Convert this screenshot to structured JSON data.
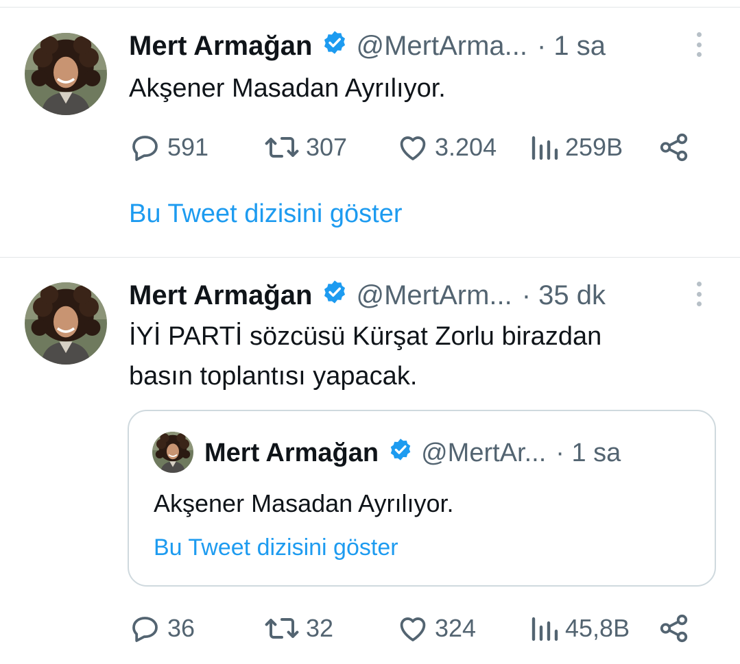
{
  "colors": {
    "text": "#0f1419",
    "secondary": "#536471",
    "link": "#1d9bf0",
    "verified": "#1d9bf0",
    "divider": "#e3e6e8"
  },
  "icons": {
    "verified": "verified-badge-icon",
    "more": "more-vertical-icon",
    "reply": "reply-bubble-icon",
    "retweet": "retweet-icon",
    "like": "heart-icon",
    "views": "views-bar-chart-icon",
    "share": "share-icon"
  },
  "tweets": [
    {
      "name": "Mert Armağan",
      "handle": "@MertArma...",
      "time": "· 1 sa",
      "text": "Akşener Masadan Ayrılıyor.",
      "replies": "591",
      "retweets": "307",
      "likes": "3.204",
      "views": "259B",
      "thread_link": "Bu Tweet dizisini göster"
    },
    {
      "name": "Mert Armağan",
      "handle": "@MertArm...",
      "time": "· 35 dk",
      "text_line1": "İYİ PARTİ sözcüsü Kürşat Zorlu birazdan",
      "text_line2": "basın toplantısı yapacak.",
      "replies": "36",
      "retweets": "32",
      "likes": "324",
      "views": "45,8B",
      "quote": {
        "name": "Mert Armağan",
        "handle": "@MertAr...",
        "time": "· 1 sa",
        "text": "Akşener Masadan Ayrılıyor.",
        "thread_link": "Bu Tweet dizisini göster"
      }
    }
  ]
}
